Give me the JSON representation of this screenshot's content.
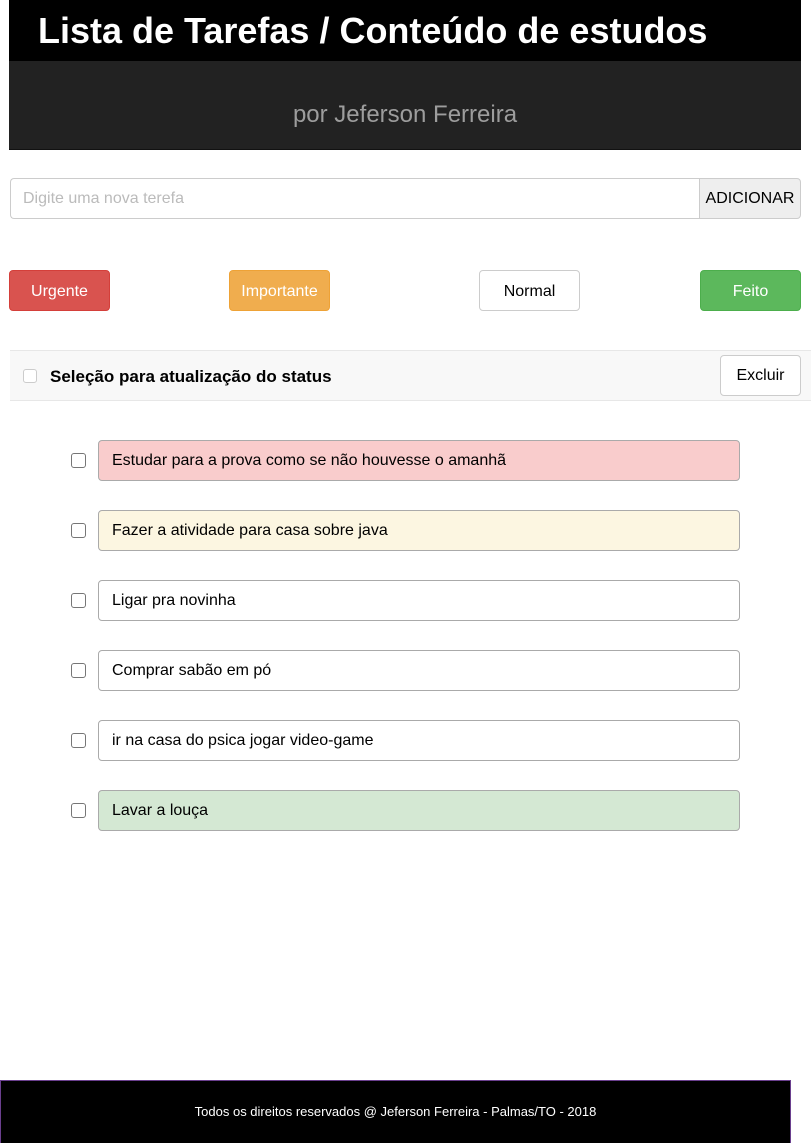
{
  "header": {
    "title": "Lista de Tarefas / Conteúdo de estudos",
    "subtitle": "por Jeferson Ferreira"
  },
  "add_task": {
    "placeholder": "Digite uma nova terefa",
    "value": "",
    "button_label": "ADICIONAR"
  },
  "priority_buttons": {
    "urgent": "Urgente",
    "important": "Importante",
    "normal": "Normal",
    "done": "Feito"
  },
  "status_bar": {
    "label": "Seleção para atualização do status",
    "delete_label": "Excluir"
  },
  "tasks": [
    {
      "text": "Estudar para a prova como se não houvesse o amanhã",
      "status": "urgent",
      "color": "#f9cccc"
    },
    {
      "text": "Fazer a atividade para casa sobre java",
      "status": "important",
      "color": "#fcf6e1"
    },
    {
      "text": "Ligar pra novinha",
      "status": "normal",
      "color": "#ffffff"
    },
    {
      "text": "Comprar sabão em pó",
      "status": "normal",
      "color": "#ffffff"
    },
    {
      "text": "ir na casa do psica jogar video-game",
      "status": "normal",
      "color": "#ffffff"
    },
    {
      "text": "Lavar a louça",
      "status": "done",
      "color": "#d4e8d3"
    }
  ],
  "footer": {
    "text": "Todos os direitos reservados @ Jeferson Ferreira - Palmas/TO - 2018"
  },
  "colors": {
    "urgent": "#d9534f",
    "important": "#f0ad4e",
    "done": "#5cb85c",
    "header_bg": "#000000",
    "subtitle_bg": "#222222"
  }
}
